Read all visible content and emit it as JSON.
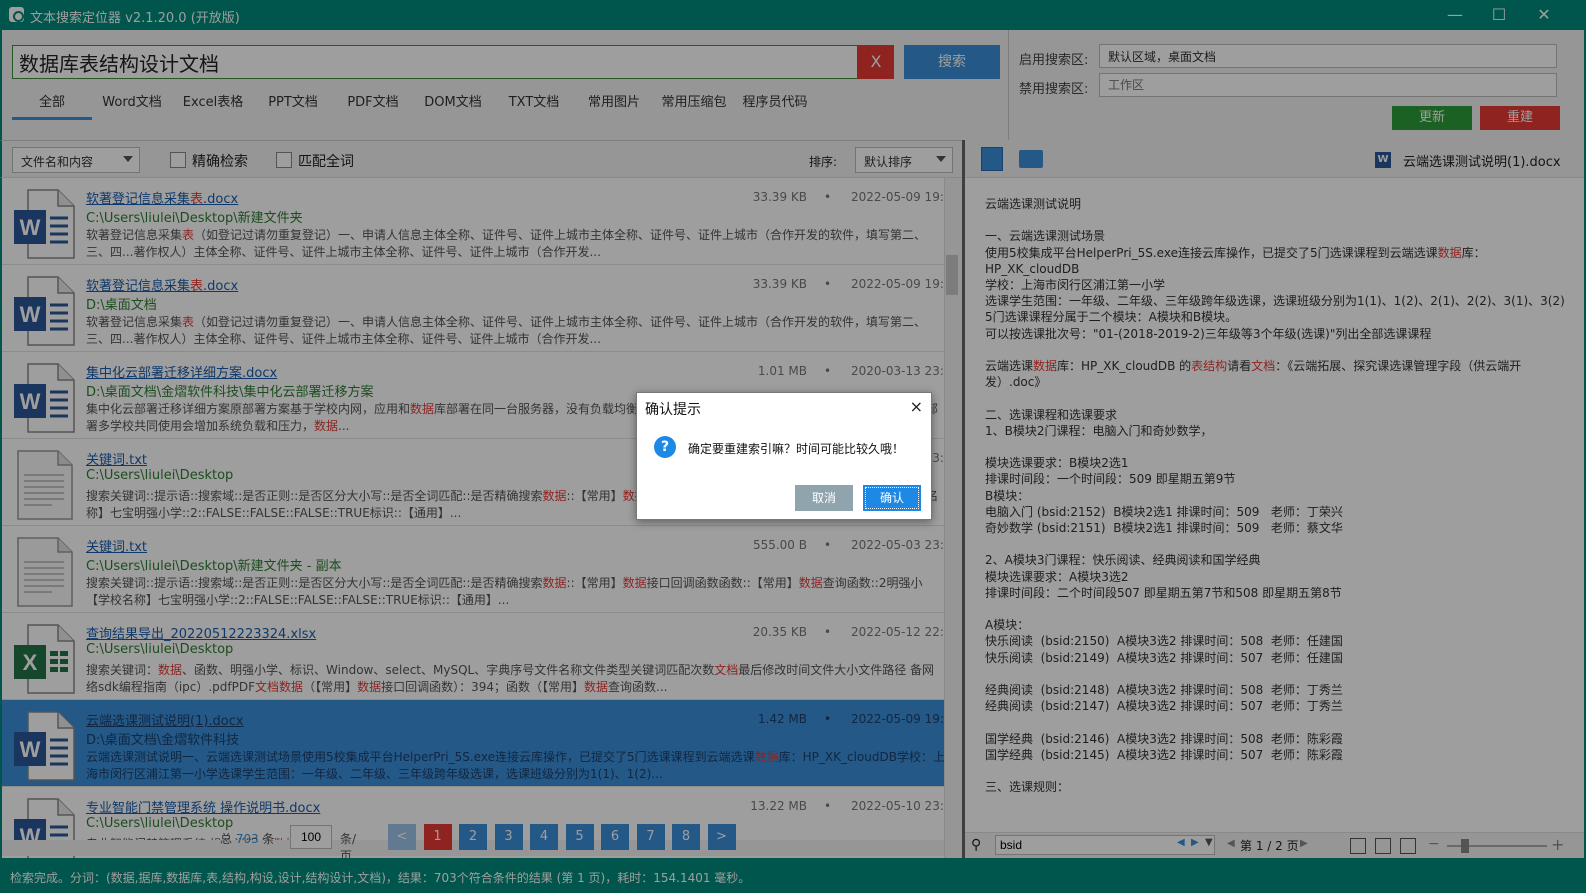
{
  "window": {
    "title": "文本搜索定位器 v2.1.20.0 (开放版)"
  },
  "search": {
    "query": "数据库表结构设计文档",
    "clear_label": "X",
    "search_label": "搜索"
  },
  "tabs": [
    "全部",
    "Word文档",
    "Excel表格",
    "PPT文档",
    "PDF文档",
    "DOM文档",
    "TXT文档",
    "常用图片",
    "常用压缩包",
    "程序员代码"
  ],
  "scope": {
    "enabled_label": "启用搜索区:",
    "enabled_value": "默认区域，桌面文档",
    "disabled_label": "禁用搜索区:",
    "disabled_placeholder": "工作区",
    "update_label": "更新",
    "rebuild_label": "重建"
  },
  "filter": {
    "mode": "文件名和内容",
    "exact_label": "精确检索",
    "whole_label": "匹配全词",
    "sort_label": "排序:",
    "sort_value": "默认排序"
  },
  "results": [
    {
      "type": "word",
      "name": "软著登记信息采集表.docx",
      "path": "C:\\Users\\liulei\\Desktop\\新建文件夹",
      "size": "33.39 KB",
      "date": "2022-05-09 19:",
      "snippet": "软著登记信息采集表（如登记过请勿重复登记）一、申请人信息主体全称、证件号、证件上城市主体全称、证件号、证件上城市（合作开发的软件，填写第二、三、四...著作权人）主体全称、证件号、证件上城市主体全称、证件号、证件上城市（合作开发..."
    },
    {
      "type": "word",
      "name": "软著登记信息采集表.docx",
      "path": "D:\\桌面文档",
      "size": "33.39 KB",
      "date": "2022-05-09 19:",
      "snippet": "软著登记信息采集表（如登记过请勿重复登记）一、申请人信息主体全称、证件号、证件上城市主体全称、证件号、证件上城市（合作开发的软件，填写第二、三、四...著作权人）主体全称、证件号、证件上城市主体全称、证件号、证件上城市（合作开发..."
    },
    {
      "type": "word",
      "name": "集中化云部署迁移详细方案.docx",
      "path": "D:\\桌面文档\\金熠软件科技\\集中化云部署迁移方案",
      "size": "1.01 MB",
      "date": "2020-03-13 23:",
      "snippet": "集中化云部署迁移详细方案原部署方案基于学校内网，应用和数据库部署在同一台服务器，没有负载均衡，系统本身支持多学校部署一个环境共同使用。集中化部署多学校共同使用会增加系统负载和压力，数据..."
    },
    {
      "type": "txt",
      "name": "关键词.txt",
      "path": "C:\\Users\\liulei\\Desktop",
      "size": "",
      "date": "2022-05-03 23:",
      "snippet": "搜索关键词::提示语::搜索域::是否正则::是否区分大小写::是否全词匹配::是否精确搜索数据::【常用】数据接口回调函数函数::【常用】数据查询函数::2 【学校名称】七宝明强小学::2::FALSE::FALSE::FALSE::TRUE标识::【通用】..."
    },
    {
      "type": "txt",
      "name": "关键词.txt",
      "path": "C:\\Users\\liulei\\Desktop\\新建文件夹 - 副本",
      "size": "555.00 B",
      "date": "2022-05-03 23:",
      "snippet": "搜索关键词::提示语::搜索域::是否正则::是否区分大小写::是否全词匹配::是否精确搜索数据::【常用】数据接口回调函数函数::【常用】数据查询函数::2明强小 【学校名称】七宝明强小学::2::FALSE::FALSE::FALSE::TRUE标识::【通用】..."
    },
    {
      "type": "excel",
      "name": "查询结果导出_20220512223324.xlsx",
      "path": "C:\\Users\\liulei\\Desktop",
      "size": "20.35 KB",
      "date": "2022-05-12 22:",
      "snippet": "搜索关键词：数据、函数、明强小学、标识、Window、select、MySQL、字典序号文件名称文件类型关键词匹配次数文档最后修改时间文件大小文件路径 备网络sdk编程指南（ipc）.pdfPDF文档数据（【常用】数据接口回调函数）：394；函数（【常用】数据查询函数..."
    },
    {
      "type": "word",
      "name": "云端选课测试说明(1).docx",
      "path": "D:\\桌面文档\\金熠软件科技",
      "size": "1.42 MB",
      "date": "2022-05-09 19:",
      "snippet": "云端选课测试说明一、云端选课测试场景使用5校集成平台HelperPri_5S.exe连接云库操作，已提交了5门选课课程到云端选课数据库：HP_XK_cloudDB学校：上海市闵行区浦江第一小学选课学生范围：一年级、二年级、三年级跨年级选课，选课班级分别为1(1)、1(2)..."
    },
    {
      "type": "word",
      "name": "专业智能门禁管理系统 操作说明书.docx",
      "path": "C:\\Users\\liulei\\Desktop",
      "size": "13.22 MB",
      "date": "2022-05-10 23:",
      "snippet": "专业智能门禁管理系统 操作说明书 数据库..."
    }
  ],
  "pager": {
    "prefix": "总",
    "total": "703",
    "unit": "条",
    "page_size": "100",
    "per_page": "条/页",
    "prev": "<",
    "pages": [
      "1",
      "2",
      "3",
      "4",
      "5",
      "6",
      "7",
      "8"
    ],
    "next": ">"
  },
  "preview": {
    "filename": "云端选课测试说明(1).docx",
    "text": "云端选课测试说明\n\n一、云端选课测试场景\n使用5校集成平台HelperPri_5S.exe连接云库操作，已提交了5门选课课程到云端选课数据库：HP_XK_cloudDB\n学校：上海市闵行区浦江第一小学\n选课学生范围：一年级、二年级、三年级跨年级选课，选课班级分别为1(1)、1(2)、2(1)、2(2)、3(1)、3(2)\n5门选课课程分属于二个模块：A模块和B模块。\n可以按选课批次号：\"01-(2018-2019-2)三年级等3个年级(选课)\"列出全部选课课程\n\n云端选课数据库：HP_XK_cloudDB 的表结构请看文档：《云端拓展、探究课选课管理字段（供云端开发）.doc》\n\n二、选课课程和选课要求\n1、B模块2门课程：电脑入门和奇妙数学，\n\n模块选课要求：B模块2选1\n排课时间段：一个时间段：509 即星期五第9节\nB模块：\n电脑入门 (bsid:2152)  B模块2选1 排课时间：509   老师：丁荣兴\n奇妙数学 (bsid:2151)  B模块2选1 排课时间：509   老师：蔡文华\n\n2、A模块3门课程：快乐阅读、经典阅读和国学经典\n模块选课要求：A模块3选2\n排课时间段：二个时间段507 即星期五第7节和508 即星期五第8节\n\nA模块：\n快乐阅读  (bsid:2150)  A模块3选2 排课时间：508  老师：任建国\n快乐阅读  (bsid:2149)  A模块3选2 排课时间：507  老师：任建国\n\n经典阅读  (bsid:2148)  A模块3选2 排课时间：508  老师：丁秀兰\n经典阅读  (bsid:2147)  A模块3选2 排课时间：507  老师：丁秀兰\n\n国学经典  (bsid:2146)  A模块3选2 排课时间：508  老师：陈彩霞\n国学经典  (bsid:2145)  A模块3选2 排课时间：507  老师：陈彩霞\n\n三、选课规则：",
    "find_value": "bsid",
    "page_info": "第 1 / 2 页"
  },
  "status": {
    "text": "检索完成。分词：(数据,据库,数据库,表,结构,构设,设计,结构设计,文档)，结果：703个符合条件的结果 (第 1 页)，耗时：154.1401 毫秒。"
  },
  "dialog": {
    "title": "确认提示",
    "message": "确定要重建索引嘛？时间可能比较久哦！",
    "cancel_label": "取消",
    "ok_label": "确认",
    "close": "×",
    "icon": "?"
  },
  "colors": {
    "accent": "#00897b",
    "primary": "#3b8fd9",
    "danger": "#e53935",
    "success": "#2e9d3a"
  }
}
